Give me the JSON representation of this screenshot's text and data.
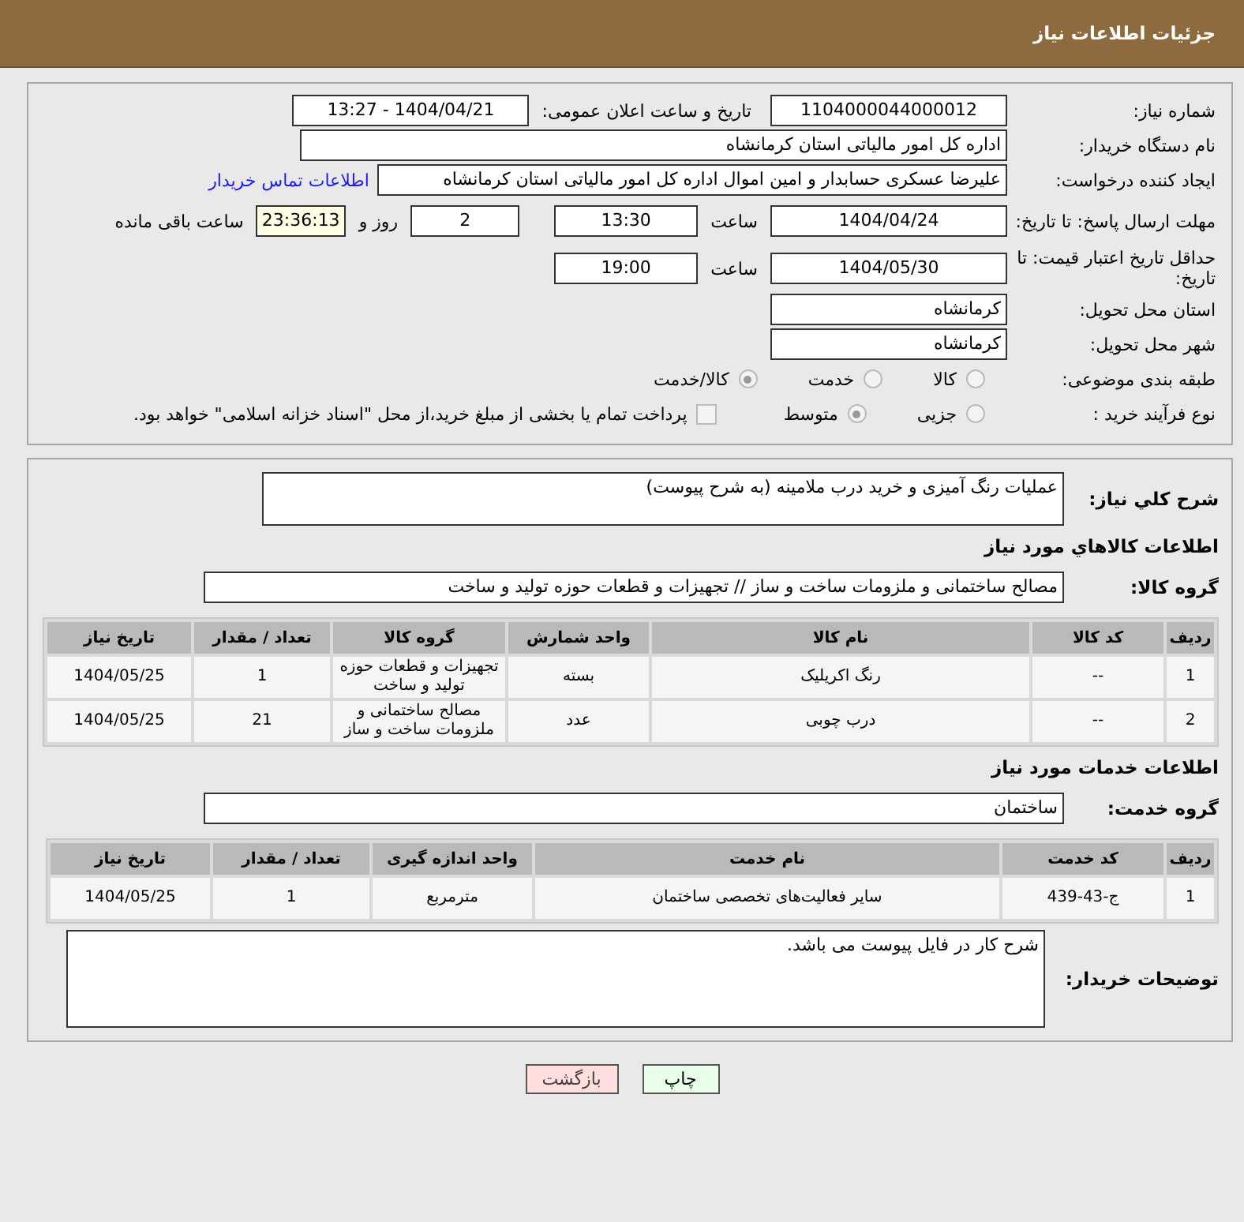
{
  "header": {
    "title": "جزئیات اطلاعات نیاز"
  },
  "details": {
    "need_number": {
      "label": "شماره نیاز:",
      "value": "1104000044000012"
    },
    "announce": {
      "label": "تاریخ و ساعت اعلان عمومی:",
      "value": "1404/04/21 - 13:27"
    },
    "buyer_org": {
      "label": "نام دستگاه خریدار:",
      "value": "اداره کل امور مالیاتی استان کرمانشاه"
    },
    "requester": {
      "label": "ایجاد کننده درخواست:",
      "value": "علیرضا عسکری حسابدار و امین اموال اداره کل امور مالیاتی استان کرمانشاه",
      "link": "اطلاعات تماس خریدار"
    },
    "reply_deadline": {
      "label": "مهلت ارسال پاسخ: تا تاریخ:",
      "date": "1404/04/24",
      "time_label": "ساعت",
      "time": "13:30",
      "days": "2",
      "days_label": "روز و",
      "remaining": "23:36:13",
      "remaining_label": "ساعت باقی مانده"
    },
    "price_validity": {
      "label": "حداقل تاریخ اعتبار قیمت: تا تاریخ:",
      "date": "1404/05/30",
      "time_label": "ساعت",
      "time": "19:00"
    },
    "province": {
      "label": "استان محل تحویل:",
      "value": "کرمانشاه"
    },
    "city": {
      "label": "شهر محل تحویل:",
      "value": "کرمانشاه"
    },
    "category": {
      "label": "طبقه بندی موضوعی:",
      "options": [
        {
          "label": "کالا",
          "selected": false
        },
        {
          "label": "خدمت",
          "selected": false
        },
        {
          "label": "کالا/خدمت",
          "selected": true
        }
      ]
    },
    "process": {
      "label": "نوع فرآیند خرید :",
      "options": [
        {
          "label": "جزیی",
          "selected": false
        },
        {
          "label": "متوسط",
          "selected": true
        }
      ],
      "payment": {
        "checked": false,
        "text": "پرداخت تمام یا بخشی از مبلغ خرید،از محل \"اسناد خزانه اسلامی\" خواهد بود."
      }
    }
  },
  "summary": {
    "label": "شرح کلي نیاز:",
    "value": "عملیات رنگ آمیزی و خرید درب ملامینه (به شرح پیوست)"
  },
  "goods": {
    "heading": "اطلاعات کالاهاي مورد نیاز",
    "group_label": "گروه کالا:",
    "group": "مصالح ساختمانی و ملزومات ساخت و ساز // تجهیزات و قطعات حوزه تولید و ساخت",
    "columns": [
      "ردیف",
      "کد کالا",
      "نام کالا",
      "واحد شمارش",
      "گروه کالا",
      "تعداد / مقدار",
      "تاریخ نیاز"
    ],
    "rows": [
      [
        "1",
        "--",
        "رنگ اکریلیک",
        "بسته",
        "تجهیزات و قطعات حوزه تولید و ساخت",
        "1",
        "1404/05/25"
      ],
      [
        "2",
        "--",
        "درب چوبی",
        "عدد",
        "مصالح ساختمانی و ملزومات ساخت و ساز",
        "21",
        "1404/05/25"
      ]
    ]
  },
  "services": {
    "heading": "اطلاعات خدمات مورد نیاز",
    "group_label": "گروه خدمت:",
    "group": "ساختمان",
    "columns": [
      "ردیف",
      "کد خدمت",
      "نام خدمت",
      "واحد اندازه گیری",
      "تعداد / مقدار",
      "تاریخ نیاز"
    ],
    "rows": [
      [
        "1",
        "ج-43-439",
        "سایر فعالیت‌های تخصصی ساختمان",
        "مترمربع",
        "1",
        "1404/05/25"
      ]
    ]
  },
  "buyer_notes": {
    "label": "توضیحات خریدار:",
    "value": "شرح کار در فایل پیوست می باشد."
  },
  "buttons": [
    {
      "label": "چاپ",
      "kind": "print"
    },
    {
      "label": "بازگشت",
      "kind": "back"
    }
  ]
}
